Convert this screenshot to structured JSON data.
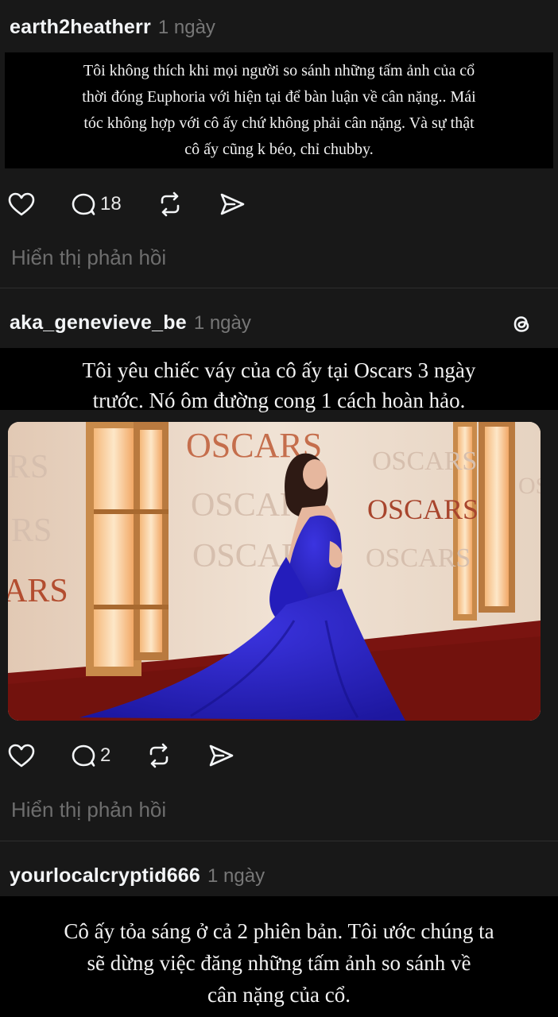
{
  "posts": [
    {
      "username": "earth2heatherr",
      "time": "1 ngày",
      "text": "Tôi không thích khi mọi người so sánh những tấm ảnh của cổ\nthời đóng Euphoria với hiện tại để bàn luận về cân nặng.. Mái\ntóc không hợp với cô ấy chứ không phải cân nặng. Và sự thật\ncô ấy cũng k béo, chỉ chubby.",
      "reply_count": "18",
      "show_replies": "Hiển thị phản hồi"
    },
    {
      "username": "aka_genevieve_be",
      "time": "1 ngày",
      "text": "Tôi yêu chiếc váy của cô ấy tại Oscars 3 ngày\ntrước. Nó ôm đường cong 1 cách hoàn hảo.",
      "reply_count": "2",
      "show_replies": "Hiển thị phản hồi",
      "photo": {
        "wall_text": [
          "OSCARS",
          "OSCARS",
          "OSCARS",
          "OSCARS",
          "OSCARS",
          "OSCARS",
          "OSCARS",
          "RS",
          "RS",
          "ARS"
        ],
        "colors": {
          "gown": "#2a22c9",
          "carpet": "#7a1410",
          "wall": "#ead6c3",
          "gold": "#c88a4a"
        }
      }
    },
    {
      "username": "yourlocalcryptid666",
      "time": "1 ngày",
      "text": "Cô ấy tỏa sáng ở cả 2 phiên bản. Tôi ước chúng ta\nsẽ dừng việc đăng những tấm ảnh so sánh về\ncân nặng của cổ."
    }
  ],
  "icons": {
    "like": "heart-icon",
    "comment": "comment-icon",
    "repost": "repost-icon",
    "share": "share-icon",
    "brand": "threads-logo-icon"
  }
}
